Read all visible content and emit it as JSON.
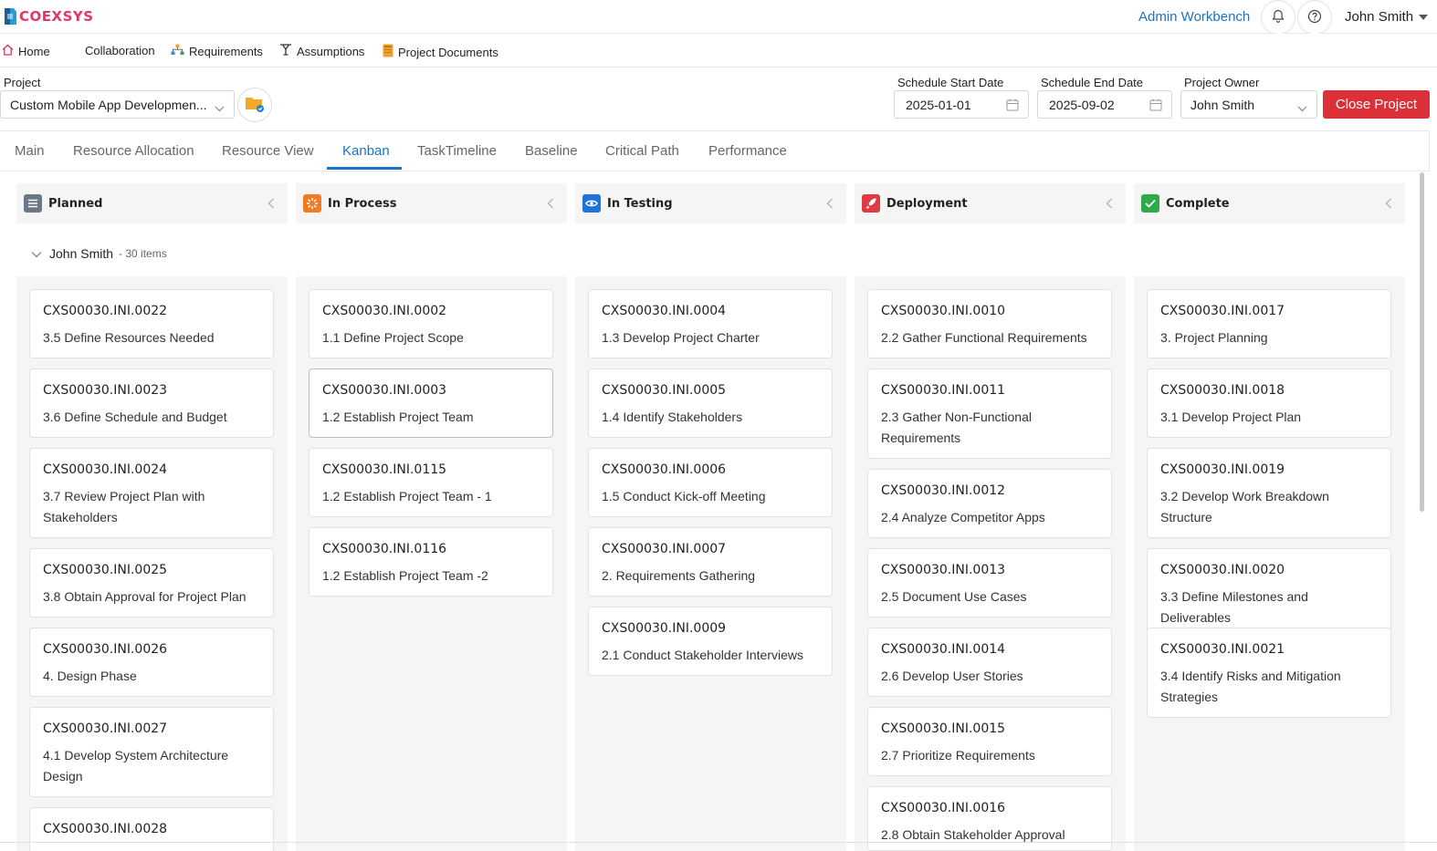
{
  "header": {
    "brand": "COEXSYS",
    "admin_link": "Admin Workbench",
    "user_name": "John Smith",
    "icons": {
      "notifications": "bell-icon",
      "help": "question-circle-icon",
      "user_caret": "caret-down-icon"
    }
  },
  "nav": {
    "items": [
      {
        "label": "Home",
        "icon": "home-icon"
      },
      {
        "label": "Collaboration",
        "icon": ""
      },
      {
        "label": "Requirements",
        "icon": "hierarchy-icon"
      },
      {
        "label": "Assumptions",
        "icon": "branch-icon"
      },
      {
        "label": "Project Documents",
        "icon": "document-icon"
      }
    ]
  },
  "project_bar": {
    "project_label": "Project",
    "project_value": "Custom Mobile App Developmen...",
    "start_label": "Schedule Start Date",
    "start_value": "2025-01-01",
    "end_label": "Schedule End Date",
    "end_value": "2025-09-02",
    "owner_label": "Project Owner",
    "owner_value": "John Smith",
    "close_button": "Close Project"
  },
  "tabs": [
    "Main",
    "Resource Allocation",
    "Resource View",
    "Kanban",
    "TaskTimeline",
    "Baseline",
    "Critical Path",
    "Performance"
  ],
  "active_tab": "Kanban",
  "board": {
    "group": {
      "name": "John Smith",
      "count": "- 30 items"
    },
    "columns": [
      {
        "title": "Planned",
        "icon": "list-icon",
        "color": "#6b7785",
        "cards": [
          {
            "id": "CXS00030.INI.0022",
            "title": "3.5 Define Resources Needed"
          },
          {
            "id": "CXS00030.INI.0023",
            "title": "3.6 Define Schedule and Budget"
          },
          {
            "id": "CXS00030.INI.0024",
            "title": "3.7 Review Project Plan with Stakeholders"
          },
          {
            "id": "CXS00030.INI.0025",
            "title": "3.8 Obtain Approval for Project Plan"
          },
          {
            "id": "CXS00030.INI.0026",
            "title": "4. Design Phase"
          },
          {
            "id": "CXS00030.INI.0027",
            "title": "4.1 Develop System Architecture Design"
          },
          {
            "id": "CXS00030.INI.0028",
            "title": ""
          }
        ]
      },
      {
        "title": "In Process",
        "icon": "spinner-icon",
        "color": "#f07b22",
        "cards": [
          {
            "id": "CXS00030.INI.0002",
            "title": "1.1 Define Project Scope"
          },
          {
            "id": "CXS00030.INI.0003",
            "title": "1.2 Establish Project Team"
          },
          {
            "id": "CXS00030.INI.0115",
            "title": "1.2 Establish Project Team - 1"
          },
          {
            "id": "CXS00030.INI.0116",
            "title": "1.2 Establish Project Team -2"
          }
        ]
      },
      {
        "title": "In Testing",
        "icon": "eye-icon",
        "color": "#1d74d8",
        "cards": [
          {
            "id": "CXS00030.INI.0004",
            "title": "1.3 Develop Project Charter"
          },
          {
            "id": "CXS00030.INI.0005",
            "title": "1.4 Identify Stakeholders"
          },
          {
            "id": "CXS00030.INI.0006",
            "title": "1.5 Conduct Kick-off Meeting"
          },
          {
            "id": "CXS00030.INI.0007",
            "title": "2. Requirements Gathering"
          },
          {
            "id": "CXS00030.INI.0009",
            "title": "2.1 Conduct Stakeholder Interviews"
          }
        ]
      },
      {
        "title": "Deployment",
        "icon": "rocket-icon",
        "color": "#e03a45",
        "cards": [
          {
            "id": "CXS00030.INI.0010",
            "title": "2.2 Gather Functional Requirements"
          },
          {
            "id": "CXS00030.INI.0011",
            "title": "2.3 Gather Non-Functional Requirements"
          },
          {
            "id": "CXS00030.INI.0012",
            "title": "2.4 Analyze Competitor Apps"
          },
          {
            "id": "CXS00030.INI.0013",
            "title": "2.5 Document Use Cases"
          },
          {
            "id": "CXS00030.INI.0014",
            "title": "2.6 Develop User Stories"
          },
          {
            "id": "CXS00030.INI.0015",
            "title": "2.7 Prioritize Requirements"
          },
          {
            "id": "CXS00030.INI.0016",
            "title": "2.8 Obtain Stakeholder Approval"
          }
        ]
      },
      {
        "title": "Complete",
        "icon": "check-icon",
        "color": "#2eaa4a",
        "cards": [
          {
            "id": "CXS00030.INI.0017",
            "title": "3. Project Planning"
          },
          {
            "id": "CXS00030.INI.0018",
            "title": "3.1 Develop Project Plan"
          },
          {
            "id": "CXS00030.INI.0019",
            "title": "3.2 Develop Work Breakdown Structure"
          },
          {
            "id": "CXS00030.INI.0020",
            "title": "3.3 Define Milestones and Deliverables"
          },
          {
            "id": "CXS00030.INI.0021",
            "title": "3.4 Identify Risks and Mitigation Strategies"
          }
        ]
      }
    ]
  }
}
